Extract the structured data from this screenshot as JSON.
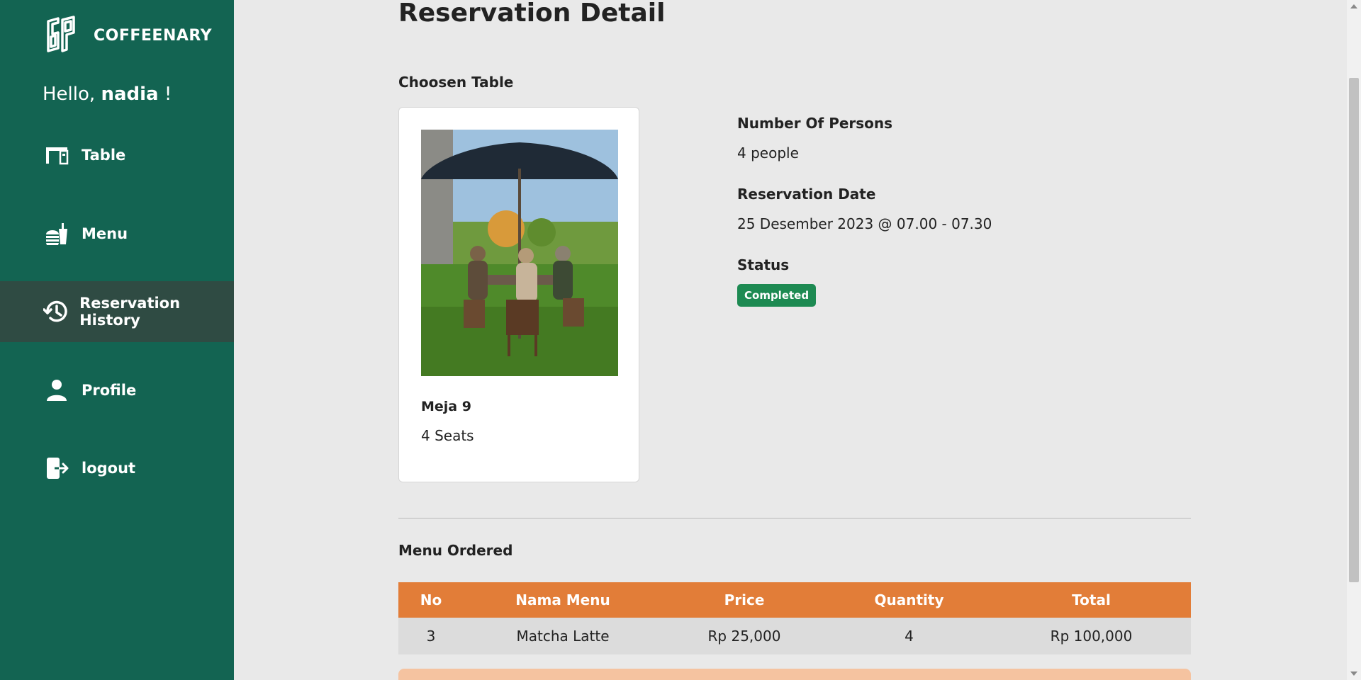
{
  "brand": {
    "name": "COFFEENARY"
  },
  "greeting": {
    "prefix": "Hello,",
    "username": "nadia",
    "suffix": "!"
  },
  "sidebar": {
    "items": [
      {
        "label": "Table",
        "icon": "table-icon",
        "active": false
      },
      {
        "label": "Menu",
        "icon": "food-icon",
        "active": false
      },
      {
        "label": "Reservation History",
        "icon": "history-icon",
        "active": true
      },
      {
        "label": "Profile",
        "icon": "user-icon",
        "active": false
      },
      {
        "label": "logout",
        "icon": "logout-icon",
        "active": false
      }
    ]
  },
  "page": {
    "title": "Reservation Detail"
  },
  "chosen_table": {
    "heading": "Choosen Table",
    "name": "Meja 9",
    "seats": "4 Seats"
  },
  "details": {
    "persons_label": "Number Of Persons",
    "persons_value": "4 people",
    "date_label": "Reservation Date",
    "date_value": "25 Desember 2023 @ 07.00 - 07.30",
    "status_label": "Status",
    "status_value": "Completed"
  },
  "orders": {
    "heading": "Menu Ordered",
    "columns": [
      "No",
      "Nama Menu",
      "Price",
      "Quantity",
      "Total"
    ],
    "rows": [
      [
        "3",
        "Matcha Latte",
        "Rp 25,000",
        "4",
        "Rp 100,000"
      ]
    ]
  },
  "colors": {
    "sidebar": "#136452",
    "sidebar_active": "#2f4b43",
    "table_header": "#e27d38",
    "status_badge": "#1d8a52",
    "background": "#e9e9e9"
  }
}
